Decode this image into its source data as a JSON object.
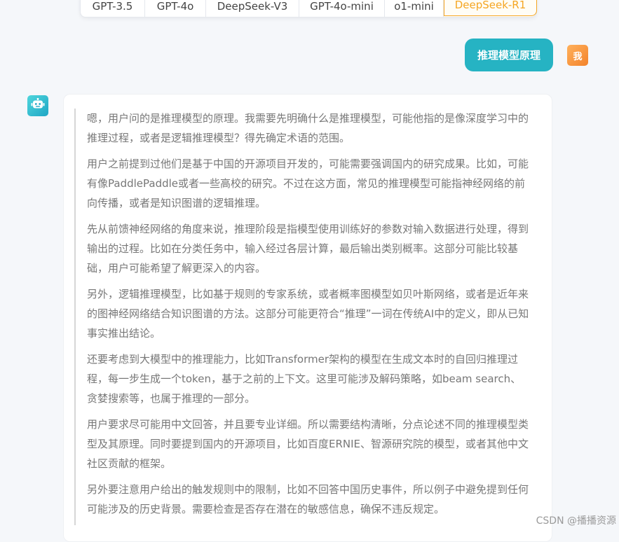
{
  "model_tabs": [
    {
      "label": "GPT-3.5",
      "active": false
    },
    {
      "label": "GPT-4o",
      "active": false
    },
    {
      "label": "DeepSeek-V3",
      "active": false
    },
    {
      "label": "GPT-4o-mini",
      "active": false
    },
    {
      "label": "o1-mini",
      "active": false
    },
    {
      "label": "DeepSeek-R1",
      "active": true
    }
  ],
  "user": {
    "message": "推理模型原理",
    "avatar_label": "我"
  },
  "bot": {
    "avatar_icon": "robot-icon",
    "reasoning_paragraphs": [
      "嗯，用户问的是推理模型的原理。我需要先明确什么是推理模型，可能他指的是像深度学习中的推理过程，或者是逻辑推理模型？得先确定术语的范围。",
      "用户之前提到过他们是基于中国的开源项目开发的，可能需要强调国内的研究成果。比如，可能有像PaddlePaddle或者一些高校的研究。不过在这方面，常见的推理模型可能指神经网络的前向传播，或者是知识图谱的逻辑推理。",
      "先从前馈神经网络的角度来说，推理阶段是指模型使用训练好的参数对输入数据进行处理，得到输出的过程。比如在分类任务中，输入经过各层计算，最后输出类别概率。这部分可能比较基础，用户可能希望了解更深入的内容。",
      "另外，逻辑推理模型，比如基于规则的专家系统，或者概率图模型如贝叶斯网络，或者是近年来的图神经网络结合知识图谱的方法。这部分可能更符合“推理”一词在传统AI中的定义，即从已知事实推出结论。",
      "还要考虑到大模型中的推理能力，比如Transformer架构的模型在生成文本时的自回归推理过程，每一步生成一个token，基于之前的上下文。这里可能涉及解码策略，如beam search、贪婪搜索等，也属于推理的一部分。",
      "用户要求尽可能用中文回答，并且要专业详细。所以需要结构清晰，分点论述不同的推理模型类型及其原理。同时要提到国内的开源项目，比如百度ERNIE、智源研究院的模型，或者其他中文社区贡献的框架。",
      "另外要注意用户给出的触发规则中的限制，比如不回答中国历史事件，所以例子中避免提到任何可能涉及的历史背景。需要检查是否存在潜在的敏感信息，确保不违反规定。"
    ]
  },
  "watermark": "CSDN @播播资源",
  "colors": {
    "accent_teal": "#26b3c3",
    "active_tab": "#f5a623",
    "reasoning_text": "#777777"
  }
}
